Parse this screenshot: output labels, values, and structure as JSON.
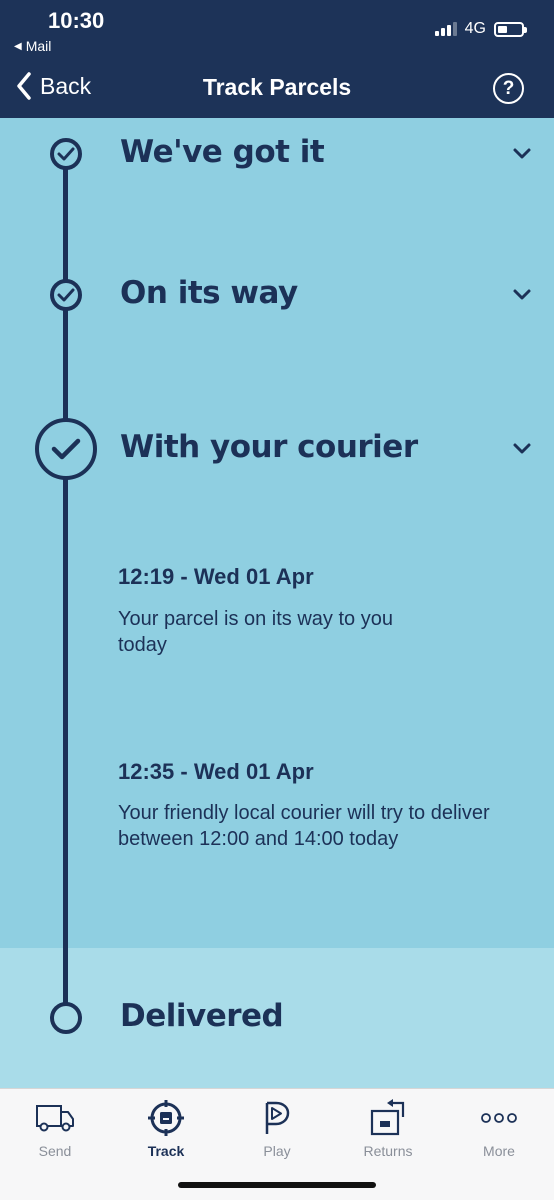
{
  "status_bar": {
    "time": "10:30",
    "back_app": "Mail",
    "network": "4G"
  },
  "nav": {
    "back_label": "Back",
    "title": "Track Parcels",
    "help_label": "?"
  },
  "timeline": {
    "stages": [
      {
        "title": "We've got it",
        "status": "complete"
      },
      {
        "title": "On its way",
        "status": "complete"
      },
      {
        "title": "With your courier",
        "status": "current"
      },
      {
        "title": "Delivered",
        "status": "pending"
      }
    ],
    "events": [
      {
        "time": "12:19 - Wed 01 Apr",
        "text": "Your parcel is on its way to you today"
      },
      {
        "time": "12:35 - Wed 01 Apr",
        "text": "Your friendly local courier will try to deliver between 12:00 and 14:00 today"
      }
    ]
  },
  "tabbar": {
    "items": [
      {
        "label": "Send",
        "icon": "van-icon"
      },
      {
        "label": "Track",
        "icon": "target-icon"
      },
      {
        "label": "Play",
        "icon": "play-p-icon"
      },
      {
        "label": "Returns",
        "icon": "returns-box-icon"
      },
      {
        "label": "More",
        "icon": "more-dots-icon"
      }
    ],
    "active": "Track"
  },
  "colors": {
    "navy": "#1d3358",
    "timeline_bg": "#8fcfe1",
    "pending_bg": "#a9dce9",
    "text": "#1c3157"
  }
}
